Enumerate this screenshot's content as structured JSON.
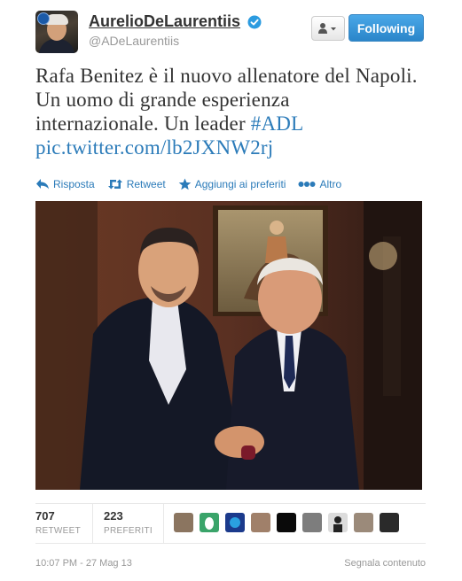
{
  "user": {
    "full_name": "AurelioDeLaurentiis",
    "screen_name": "@ADeLaurentiis"
  },
  "buttons": {
    "follow_label": "Following"
  },
  "tweet": {
    "text_line1": "Rafa Benitez è il nuovo allenatore del Napoli.",
    "text_line2": "Un uomo di grande esperienza",
    "text_line3": "internazionale. Un leader ",
    "hashtag": "#ADL",
    "link": "pic.twitter.com/lb2JXNW2rj"
  },
  "actions": {
    "reply": "Risposta",
    "retweet": "Retweet",
    "favorite": "Aggiungi ai preferiti",
    "more": "Altro"
  },
  "stats": {
    "retweets_count": "707",
    "retweets_label": "RETWEET",
    "favorites_count": "223",
    "favorites_label": "PREFERITI"
  },
  "footer": {
    "timestamp": "10:07 PM - 27 Mag 13",
    "report": "Segnala contenuto"
  },
  "colors": {
    "link_blue": "#2b7bb9",
    "follow_button": "#2a85c9"
  }
}
